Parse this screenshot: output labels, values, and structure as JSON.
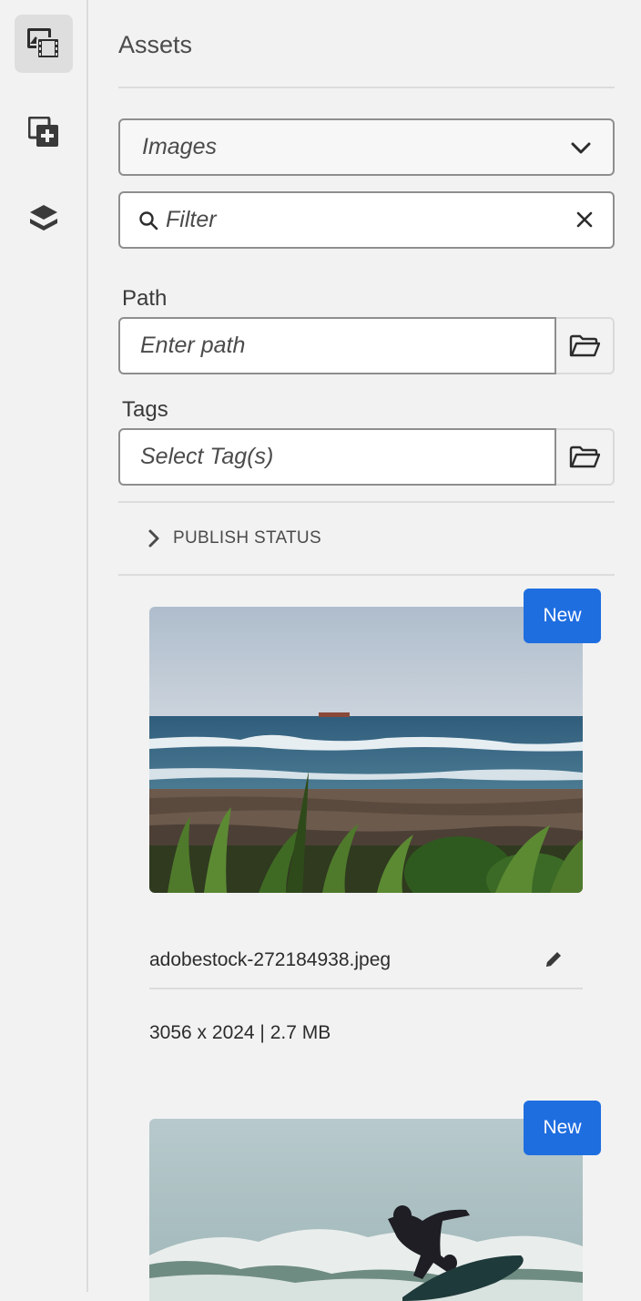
{
  "rail": {
    "items": [
      {
        "name": "assets-icon",
        "active": true
      },
      {
        "name": "components-icon",
        "active": false
      },
      {
        "name": "layers-icon",
        "active": false
      }
    ]
  },
  "panel": {
    "title": "Assets",
    "type_select": {
      "value": "Images"
    },
    "filter": {
      "placeholder": "Filter"
    },
    "path": {
      "label": "Path",
      "placeholder": "Enter path"
    },
    "tags": {
      "label": "Tags",
      "placeholder": "Select Tag(s)"
    },
    "publish_status": {
      "label": "PUBLISH STATUS",
      "expanded": false
    }
  },
  "assets": [
    {
      "badge": "New",
      "filename": "adobestock-272184938.jpeg",
      "meta": "3056 x 2024 | 2.7 MB",
      "image": "coastline-waves-photo"
    },
    {
      "badge": "New",
      "image": "surfer-photo"
    }
  ],
  "colors": {
    "accent": "#1f6ee0",
    "background": "#f2f2f2",
    "border": "#8e8e8e"
  }
}
